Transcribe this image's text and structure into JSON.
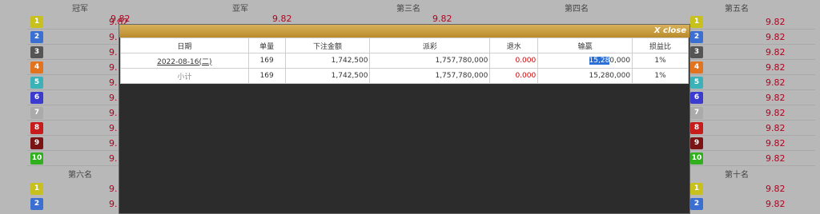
{
  "columns_top": [
    "冠军",
    "亚军",
    "第三名",
    "第四名",
    "第五名"
  ],
  "columns_bottom": [
    "第六名",
    "第十名"
  ],
  "left_values": [
    "9.82",
    "9.",
    "9.",
    "9.",
    "9.",
    "9.",
    "9.",
    "9.",
    "9.",
    "9."
  ],
  "left_values_bottom": [
    "9.",
    "9."
  ],
  "right_values": [
    "9.82",
    "9.82",
    "9.82",
    "9.82",
    "9.82",
    "9.82",
    "9.82",
    "9.82",
    "9.82",
    "9.82"
  ],
  "right_values_bottom": [
    "9.82",
    "9.82"
  ],
  "numbers": [
    "1",
    "2",
    "3",
    "4",
    "5",
    "6",
    "7",
    "8",
    "9",
    "10"
  ],
  "badge_colors": [
    "#c8c01d",
    "#3b6fd1",
    "#555555",
    "#e2731f",
    "#3bb2b8",
    "#3b3bd0",
    "#aaaaaa",
    "#c61c1c",
    "#7b1414",
    "#2fb01c"
  ],
  "header_values": [
    "9.82",
    "9.82",
    "9.82"
  ],
  "modal": {
    "close_label": "X close",
    "headers": [
      "日期",
      "单量",
      "下注金额",
      "派彩",
      "退水",
      "输赢",
      "损益比"
    ],
    "rows": [
      {
        "date": "2022-08-16(二)",
        "count": "169",
        "bet": "1,742,500",
        "payout": "1,757,780,000",
        "rebate": "0.000",
        "win_sel": "15,28",
        "win_rest": "0,000",
        "ratio": "1%"
      },
      {
        "date": "小计",
        "count": "169",
        "bet": "1,742,500",
        "payout": "1,757,780,000",
        "rebate": "0.000",
        "win": "15,280,000",
        "ratio": "1%"
      }
    ]
  }
}
